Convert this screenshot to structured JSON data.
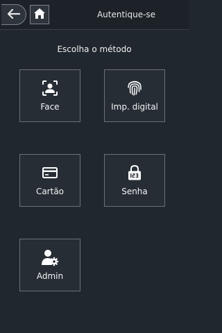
{
  "header": {
    "title": "Autentique-se"
  },
  "prompt": "Escolha o método",
  "methods": [
    {
      "label": "Face",
      "icon": "face-scan-icon"
    },
    {
      "label": "Imp. digital",
      "icon": "fingerprint-icon"
    },
    {
      "label": "Cartão",
      "icon": "card-icon"
    },
    {
      "label": "Senha",
      "icon": "password-lock-icon"
    },
    {
      "label": "Admin",
      "icon": "admin-gear-icon"
    }
  ],
  "colors": {
    "background": "#21272e",
    "tile_border": "#6a7179",
    "text": "#ffffff"
  }
}
